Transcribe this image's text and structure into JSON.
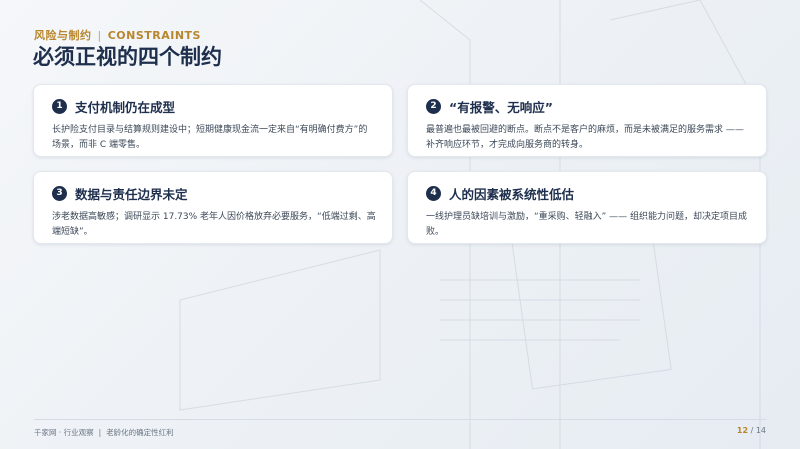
{
  "eyebrow": {
    "left": "风险与制约",
    "sep": "|",
    "right": "CONSTRAINTS"
  },
  "title": "必须正视的四个制约",
  "cards": [
    {
      "num": "1",
      "title": "支付机制仍在成型",
      "body": "长护险支付目录与结算规则建设中；短期健康现金流一定来自“有明确付费方”的场景，而非 C 端零售。"
    },
    {
      "num": "2",
      "title": "“有报警、无响应”",
      "body": "最普遍也最被回避的断点。断点不是客户的麻烦，而是未被满足的服务需求 —— 补齐响应环节，才完成向服务商的转身。"
    },
    {
      "num": "3",
      "title": "数据与责任边界未定",
      "body": "涉老数据高敏感；调研显示 17.73% 老年人因价格放弃必要服务，“低端过剩、高端短缺”。"
    },
    {
      "num": "4",
      "title": "人的因素被系统性低估",
      "body": "一线护理员缺培训与激励，“重采购、轻融入” —— 组织能力问题，却决定项目成败。"
    }
  ],
  "footer": {
    "source": "千家网 · 行业观察",
    "sep": "|",
    "subtitle": "老龄化的确定性红利",
    "page_current": "12",
    "page_sep": "/",
    "page_total": "14"
  }
}
